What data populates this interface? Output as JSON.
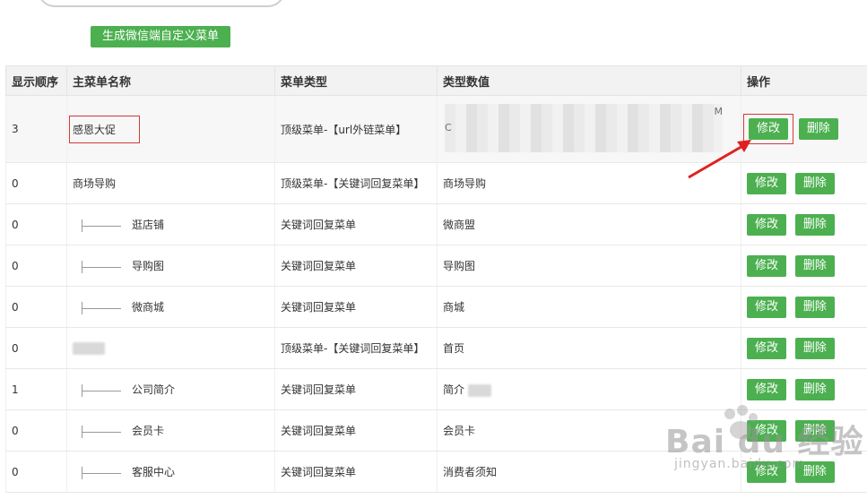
{
  "toolbar": {
    "generate_label": "生成微信端自定义菜单"
  },
  "table": {
    "headers": [
      "显示顺序",
      "主菜单名称",
      "菜单类型",
      "类型数值",
      "操作"
    ],
    "rows": [
      {
        "order": "3",
        "name": "感恩大促",
        "type": "顶级菜单-【url外链菜单】",
        "value": "",
        "child": false
      },
      {
        "order": "0",
        "name": "商场导购",
        "type": "顶级菜单-【关键词回复菜单】",
        "value": "商场导购",
        "child": false
      },
      {
        "order": "0",
        "name": "逛店铺",
        "type": "关键词回复菜单",
        "value": "微商盟",
        "child": true
      },
      {
        "order": "0",
        "name": "导购图",
        "type": "关键词回复菜单",
        "value": "导购图",
        "child": true
      },
      {
        "order": "0",
        "name": "微商城",
        "type": "关键词回复菜单",
        "value": "商城",
        "child": true
      },
      {
        "order": "0",
        "name": "",
        "type": "顶级菜单-【关键词回复菜单】",
        "value": "首页",
        "child": false
      },
      {
        "order": "1",
        "name": "公司简介",
        "type": "关键词回复菜单",
        "value": "简介",
        "child": true
      },
      {
        "order": "0",
        "name": "会员卡",
        "type": "关键词回复菜单",
        "value": "会员卡",
        "child": true
      },
      {
        "order": "0",
        "name": "客服中心",
        "type": "关键词回复菜单",
        "value": "消费者须知",
        "child": true
      }
    ],
    "edit_label": "修改",
    "delete_label": "删除"
  },
  "mosaic_letters": [
    "M",
    "C"
  ],
  "watermark": {
    "logo": "Bai du 经验",
    "sub": "jingyan.baidu.com"
  },
  "colors": {
    "button_green": "#4cb050",
    "highlight_red": "#d23a3a",
    "header_bg": "#f2f2f2"
  }
}
